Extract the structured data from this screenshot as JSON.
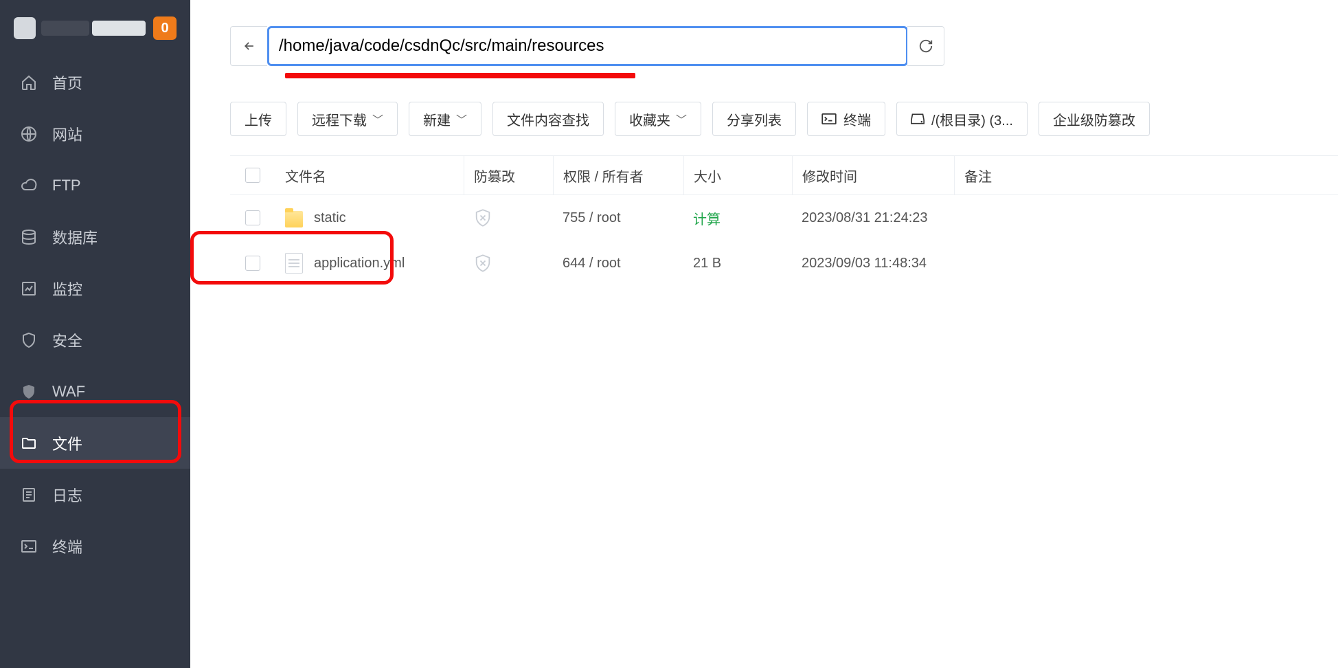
{
  "header": {
    "badge": "0"
  },
  "sidebar": {
    "items": [
      {
        "label": "首页",
        "name": "sidebar-item-home",
        "icon": "home"
      },
      {
        "label": "网站",
        "name": "sidebar-item-website",
        "icon": "globe"
      },
      {
        "label": "FTP",
        "name": "sidebar-item-ftp",
        "icon": "cloud"
      },
      {
        "label": "数据库",
        "name": "sidebar-item-database",
        "icon": "db"
      },
      {
        "label": "监控",
        "name": "sidebar-item-monitor",
        "icon": "chart"
      },
      {
        "label": "安全",
        "name": "sidebar-item-security",
        "icon": "shield"
      },
      {
        "label": "WAF",
        "name": "sidebar-item-waf",
        "icon": "waf"
      },
      {
        "label": "文件",
        "name": "sidebar-item-files",
        "icon": "folder"
      },
      {
        "label": "日志",
        "name": "sidebar-item-logs",
        "icon": "log"
      },
      {
        "label": "终端",
        "name": "sidebar-item-terminal",
        "icon": "term"
      }
    ],
    "active": 7
  },
  "path": {
    "value": "/home/java/code/csdnQc/src/main/resources"
  },
  "toolbar": {
    "upload": "上传",
    "remote_dl": "远程下载",
    "new": "新建",
    "search": "文件内容查找",
    "fav": "收藏夹",
    "share": "分享列表",
    "terminal": "终端",
    "root": "/(根目录) (3...",
    "enterprise": "企业级防篡改"
  },
  "table": {
    "headers": {
      "name": "文件名",
      "tamper": "防篡改",
      "perm": "权限 / 所有者",
      "size": "大小",
      "time": "修改时间",
      "note": "备注"
    },
    "rows": [
      {
        "type": "folder",
        "name": "static",
        "perm": "755 / root",
        "size": "计算",
        "size_class": "green",
        "time": "2023/08/31 21:24:23"
      },
      {
        "type": "file",
        "name": "application.yml",
        "perm": "644 / root",
        "size": "21 B",
        "size_class": "",
        "time": "2023/09/03 11:48:34"
      }
    ]
  }
}
